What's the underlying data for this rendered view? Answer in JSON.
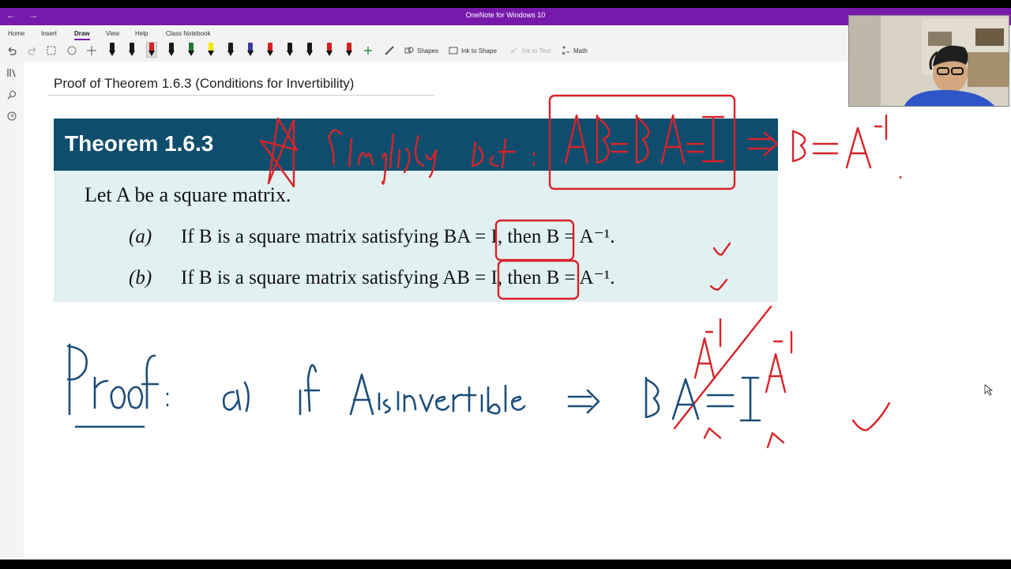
{
  "window": {
    "title": "OneNote for Windows 10",
    "back_glyph": "←",
    "forward_glyph": "→"
  },
  "ribbon": {
    "tabs": [
      "Home",
      "Insert",
      "Draw",
      "View",
      "Help",
      "Class Notebook"
    ],
    "active_tab": "Draw",
    "tools": {
      "shapes": "Shapes",
      "ink_to_shape": "Ink to Shape",
      "ink_to_text": "Ink to Text",
      "math": "Math"
    },
    "pen_colors": [
      "#1a1a1a",
      "#1a1a1a",
      "#d42020",
      "#1a1a1a",
      "#1a7a30",
      "#f5e600",
      "#1a1a1a",
      "#3a3aa8",
      "#d42020",
      "#1a1a1a",
      "#1a1a1a",
      "#d42020",
      "#d42020"
    ],
    "icons": [
      "undo-icon",
      "redo-icon",
      "lasso-select-icon",
      "eraser-icon",
      "pan-icon",
      "plus-icon",
      "ruler-icon",
      "shapes-icon",
      "ink-to-shape-icon",
      "ink-to-text-icon",
      "math-icon"
    ]
  },
  "sidebar": {
    "icons": [
      "notebooks-icon",
      "search-icon",
      "recent-icon"
    ]
  },
  "page": {
    "title": "Proof of Theorem 1.6.3 (Conditions for Invertibility)"
  },
  "theorem": {
    "label": "Theorem 1.6.3",
    "intro": "Let A be a square matrix.",
    "part_a": {
      "label": "(a)",
      "text": "If B is a square matrix satisfying BA = I, then B = A⁻¹."
    },
    "part_b": {
      "label": "(b)",
      "text": "If B is a square matrix satisfying AB = I, then B = A⁻¹."
    }
  },
  "ink": {
    "red_note": "Simplify Def : AB=BA=I ⇒ B=A⁻¹",
    "proof_text": "Proof:  a)  if A is invertible ⇒  BA = I",
    "colors": {
      "red": "#d8232a",
      "blue": "#1b4d7a"
    }
  },
  "webcam": {
    "alt": "presenter webcam"
  }
}
